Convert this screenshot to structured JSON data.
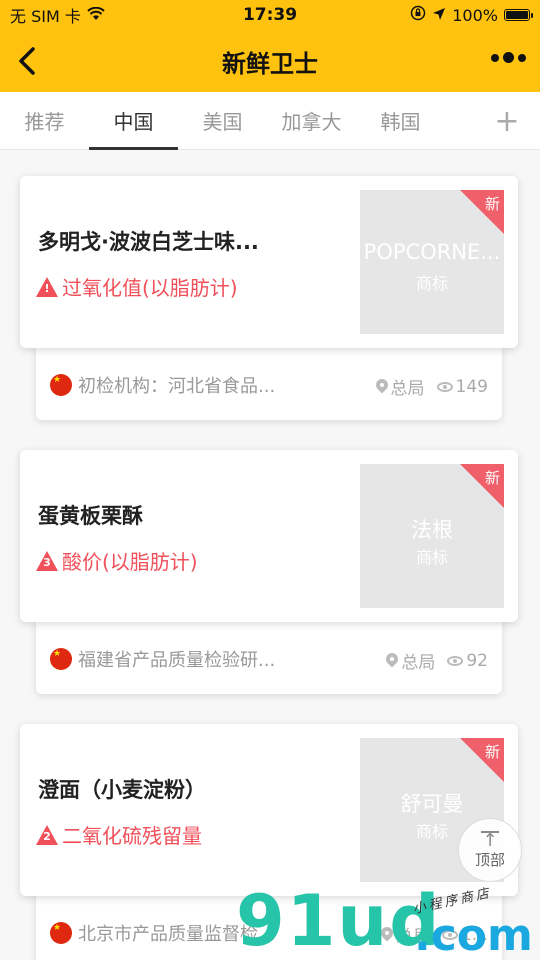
{
  "status_bar": {
    "carrier": "无 SIM 卡",
    "wifi_icon": "wifi-icon",
    "time": "17:39",
    "battery": "100%",
    "battery_level": 1.0
  },
  "nav": {
    "title": "新鲜卫士",
    "back_icon": "chevron-left-icon",
    "more_icon": "more-dots-icon"
  },
  "tabs": [
    {
      "label": "推荐",
      "active": false
    },
    {
      "label": "中国",
      "active": true
    },
    {
      "label": "美国",
      "active": false
    },
    {
      "label": "加拿大",
      "active": false
    },
    {
      "label": "韩国",
      "active": false
    }
  ],
  "tab_add_label": "+",
  "cards": [
    {
      "name": "多明戈·波波白芝士味...",
      "issue_badge": "!",
      "issue": "过氧化值(以脂肪计)",
      "brand": "POPCORNE...",
      "brand_sub": "商标",
      "new_label": "新",
      "org": "初检机构：河北省食品...",
      "location": "总局",
      "views": "149"
    },
    {
      "name": "蛋黄板栗酥",
      "issue_badge": "3",
      "issue": "酸价(以脂肪计)",
      "brand": "法根",
      "brand_sub": "商标",
      "new_label": "新",
      "org": "福建省产品质量检验研...",
      "location": "总局",
      "views": "92"
    },
    {
      "name": "澄面（小麦淀粉）",
      "issue_badge": "2",
      "issue": "二氧化硫残留量",
      "brand": "舒可曼",
      "brand_sub": "商标",
      "new_label": "新",
      "org": "北京市产品质量监督检...",
      "location": "总局",
      "views": "1..."
    }
  ],
  "top_button": {
    "label": "顶部"
  },
  "watermark": {
    "main": "91ud",
    "domain": ".com",
    "sub": "小程序商店"
  },
  "colors": {
    "brand_yellow": "#ffc20e",
    "alert_red": "#f0505a"
  }
}
